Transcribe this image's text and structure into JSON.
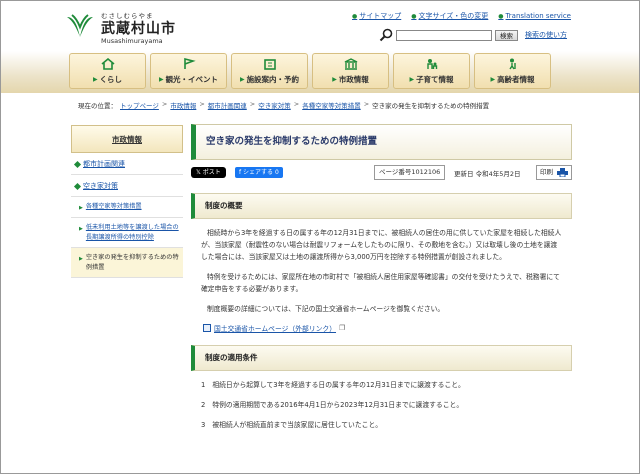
{
  "logo": {
    "kana": "むさしむらやま",
    "name": "武蔵村山市",
    "roman": "Musashimurayama"
  },
  "toplinks": [
    {
      "label": "サイトマップ"
    },
    {
      "label": "文字サイズ・色の変更"
    },
    {
      "label": "Translation service"
    }
  ],
  "search": {
    "button": "検索",
    "help": "検索の使い方",
    "value": ""
  },
  "nav": [
    {
      "label": "くらし"
    },
    {
      "label": "観光・イベント"
    },
    {
      "label": "施設案内・予約"
    },
    {
      "label": "市政情報"
    },
    {
      "label": "子育て情報"
    },
    {
      "label": "高齢者情報"
    }
  ],
  "breadcrumb": {
    "prefix": "現在の位置：",
    "items": [
      "トップページ",
      "市政情報",
      "都市計画関連",
      "空き家対策",
      "各種空家等対策措置"
    ],
    "current": "空き家の発生を抑制するための特例措置"
  },
  "sidebar": {
    "heading": "市政情報",
    "level1": [
      "都市計画関連",
      "空き家対策"
    ],
    "level2": [
      {
        "label": "各種空家等対策措置",
        "current": false
      },
      {
        "label": "低未利用土地等を譲渡した場合の長期譲渡所得の特別控除",
        "current": false
      },
      {
        "label": "空き家の発生を抑制するための特例措置",
        "current": true
      }
    ]
  },
  "main": {
    "title": "空き家の発生を抑制するための特例措置",
    "share_x": "ポスト",
    "share_fb": "シェアする 0",
    "page_no": "ページ番号1012106",
    "updated": "更新日  令和4年5月2日",
    "print": "印刷",
    "section1": "制度の概要",
    "para1": "相続時から3年を経過する日の属する年の12月31日までに、被相続人の居住の用に供していた家屋を相続した相続人が、当該家屋（耐震性のない場合は耐震リフォームをしたものに限り、その敷地を含む。）又は取壊し後の土地を譲渡した場合には、当該家屋又は土地の譲渡所得から3,000万円を控除する特例措置が創設されました。",
    "para2": "特例を受けるためには、家屋所在地の市町村で「被相続人居住用家屋等確認書」の交付を受けたうえで、税務署にて確定申告をする必要があります。",
    "para3": "制度概要の詳細については、下記の国土交通省ホームページを御覧ください。",
    "ext_link": "国土交通省ホームページ（外部リンク）",
    "section2": "制度の適用条件",
    "conds": [
      {
        "n": "1",
        "text": "相続日から起算して3年を経過する日の属する年の12月31日までに譲渡すること。"
      },
      {
        "n": "2",
        "text": "特例の適用期間である2016年4月1日から2023年12月31日までに譲渡すること。"
      },
      {
        "n": "3",
        "text": "被相続人が相続直前まで当該家屋に居住していたこと。"
      }
    ]
  }
}
